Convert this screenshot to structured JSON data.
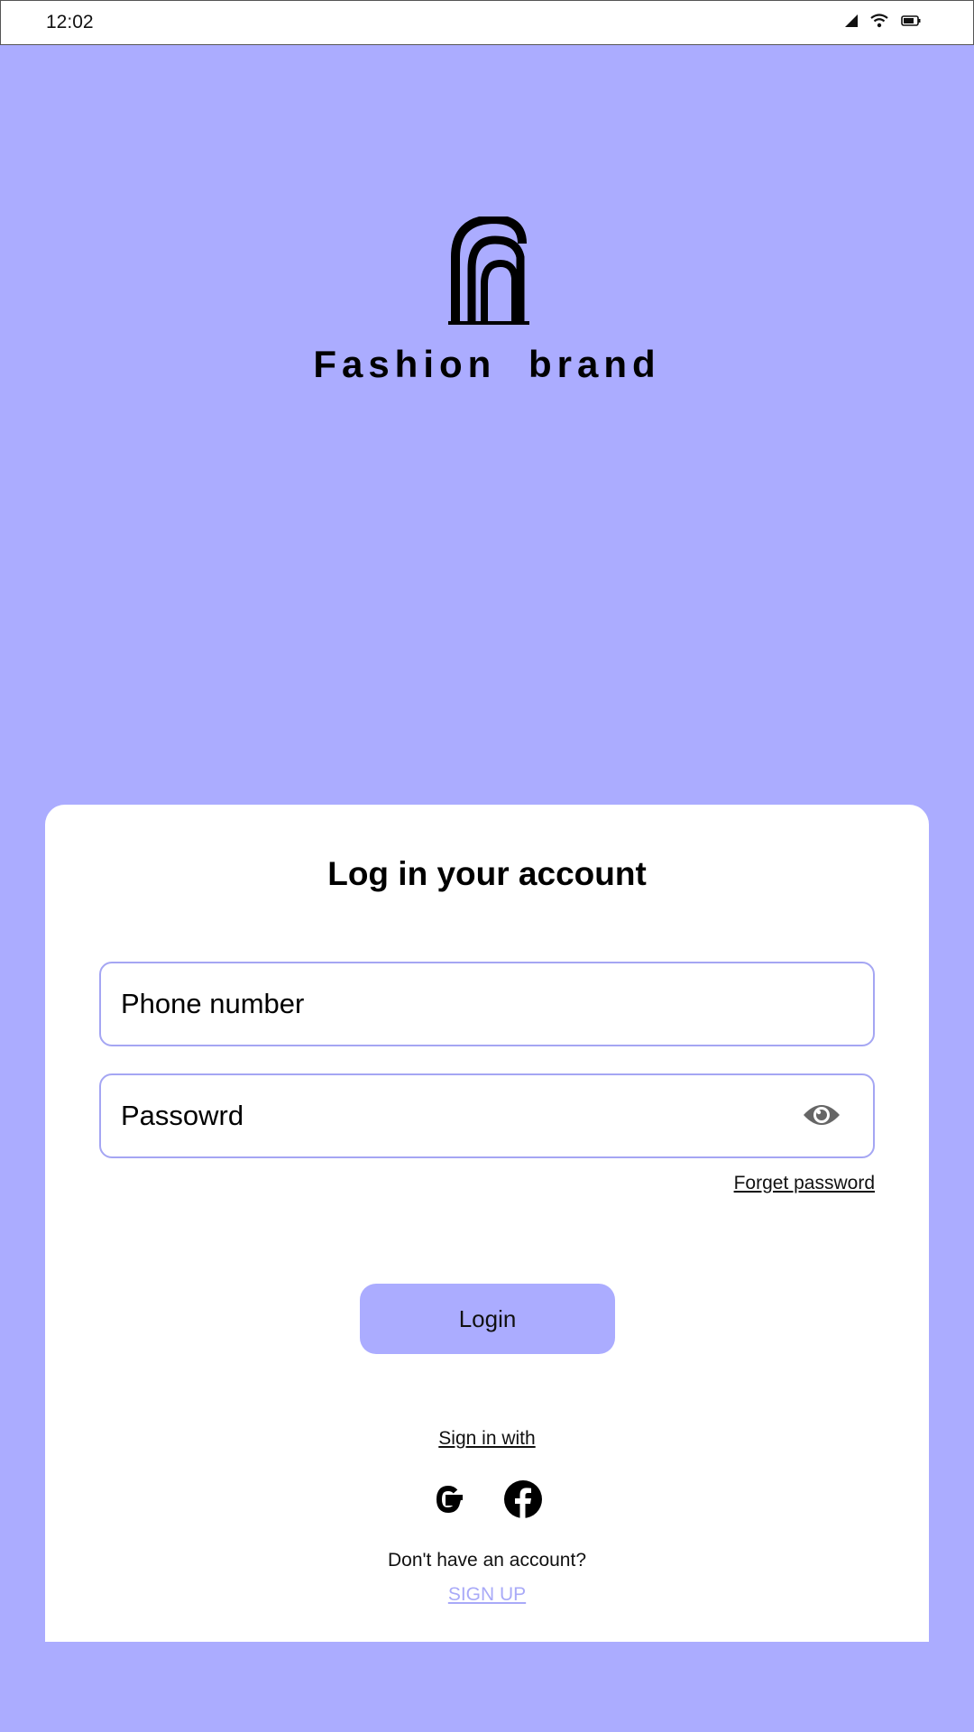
{
  "status_bar": {
    "time": "12:02",
    "icons": [
      "signal-icon",
      "wifi-icon",
      "battery-icon"
    ]
  },
  "brand": {
    "logo_icon": "fashion-brand-logo",
    "name": "Fashion  brand"
  },
  "login_card": {
    "title": "Log in your account",
    "phone_placeholder": "Phone number",
    "password_placeholder": "Passowrd",
    "password_toggle_icon": "eye-icon",
    "forgot_password": "Forget password",
    "login_button": "Login",
    "sign_in_with": "Sign in with",
    "social_icons": [
      "google-icon",
      "facebook-icon"
    ],
    "no_account_text": "Don't have an account?",
    "sign_up": "SIGN UP"
  },
  "colors": {
    "background": "#abacff",
    "card": "#ffffff",
    "field_border": "#a5a6f3",
    "sign_up_link": "#a9aaf8"
  }
}
